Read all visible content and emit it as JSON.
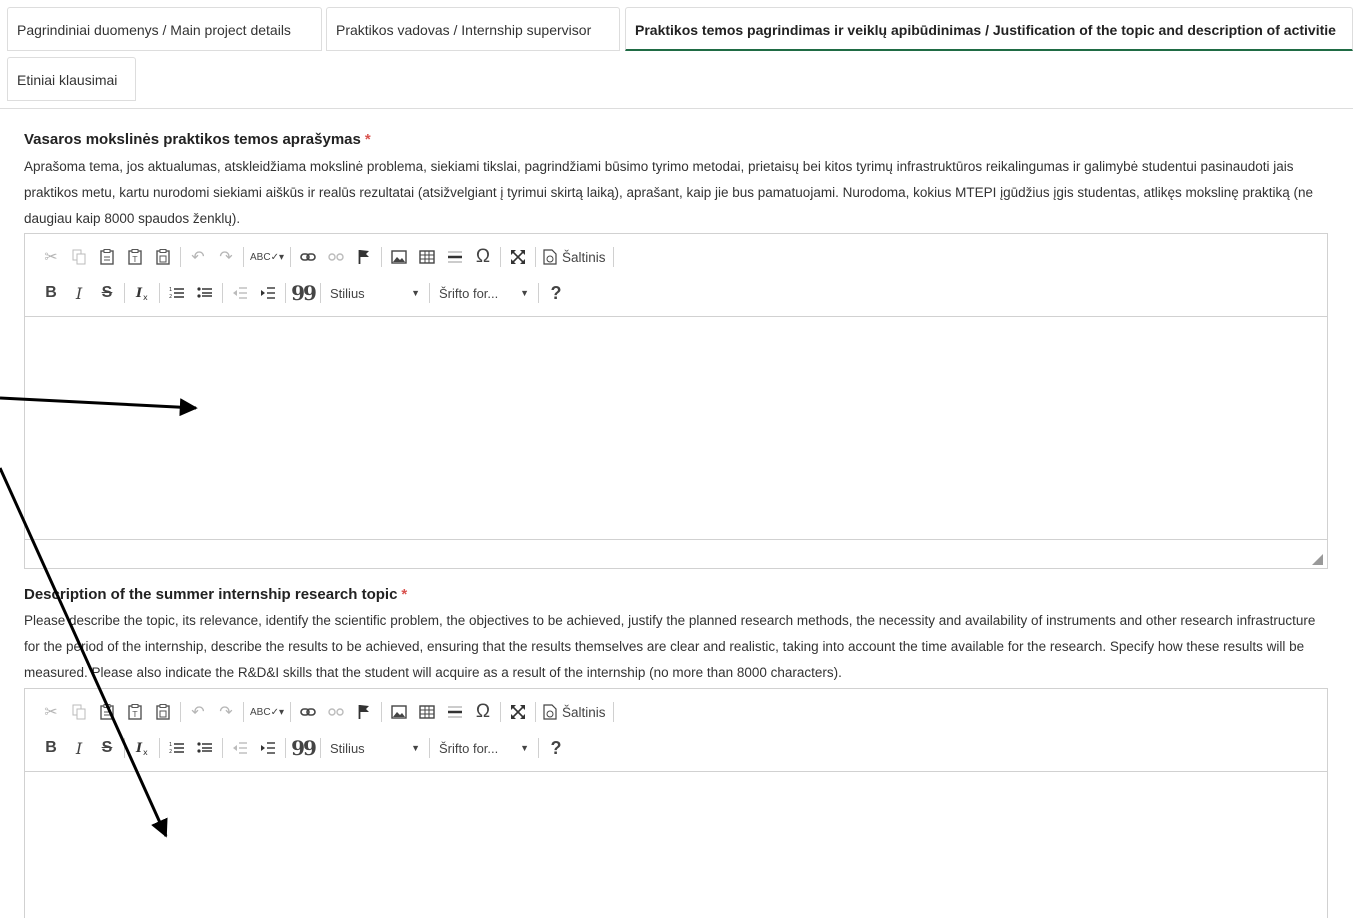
{
  "tabs": [
    {
      "label": "Pagrindiniai duomenys / Main project details"
    },
    {
      "label": "Praktikos vadovas / Internship supervisor"
    },
    {
      "label": "Praktikos temos pagrindimas ir veiklų apibūdinimas / Justification of the topic and description of activitie"
    },
    {
      "label": "Etiniai klausimai"
    }
  ],
  "sections": [
    {
      "title": "Vasaros mokslinės praktikos temos aprašymas",
      "required_mark": "*",
      "description": "Aprašoma tema, jos aktualumas, atskleidžiama mokslinė problema, siekiami tikslai, pagrindžiami būsimo tyrimo metodai, prietaisų bei kitos tyrimų infrastruktūros reikalingumas ir galimybė studentui pasinaudoti jais praktikos metu, kartu nurodomi siekiami aiškūs ir realūs rezultatai (atsižvelgiant į tyrimui skirtą laiką), aprašant, kaip jie bus pamatuojami. Nurodoma, kokius MTEPI įgūdžius įgis studentas, atlikęs mokslinę praktiką (ne daugiau kaip 8000 spaudos ženklų)."
    },
    {
      "title": "Description of the summer internship research topic",
      "required_mark": "*",
      "description": "Please describe the topic, its relevance, identify the scientific problem, the objectives to be achieved, justify the planned research methods, the necessity and availability of instruments and other research infrastructure for the period of the internship, describe the results to be achieved, ensuring that the results themselves are clear and realistic, taking into account the time available for the research. Specify how these results will be measured. Please also indicate the R&D&I skills that the student will acquire as a result of the internship (no more than 8000 characters)."
    }
  ],
  "editor": {
    "source_label": "Šaltinis",
    "style_label": "Stilius",
    "font_label": "Šrifto for...",
    "help_label": "?",
    "omega_glyph": "Ω",
    "quote_glyph": "99",
    "bold_glyph": "B",
    "italic_glyph": "I",
    "strike_glyph": "S",
    "spell_glyph": "ABC"
  },
  "annotation_color": "#000000"
}
